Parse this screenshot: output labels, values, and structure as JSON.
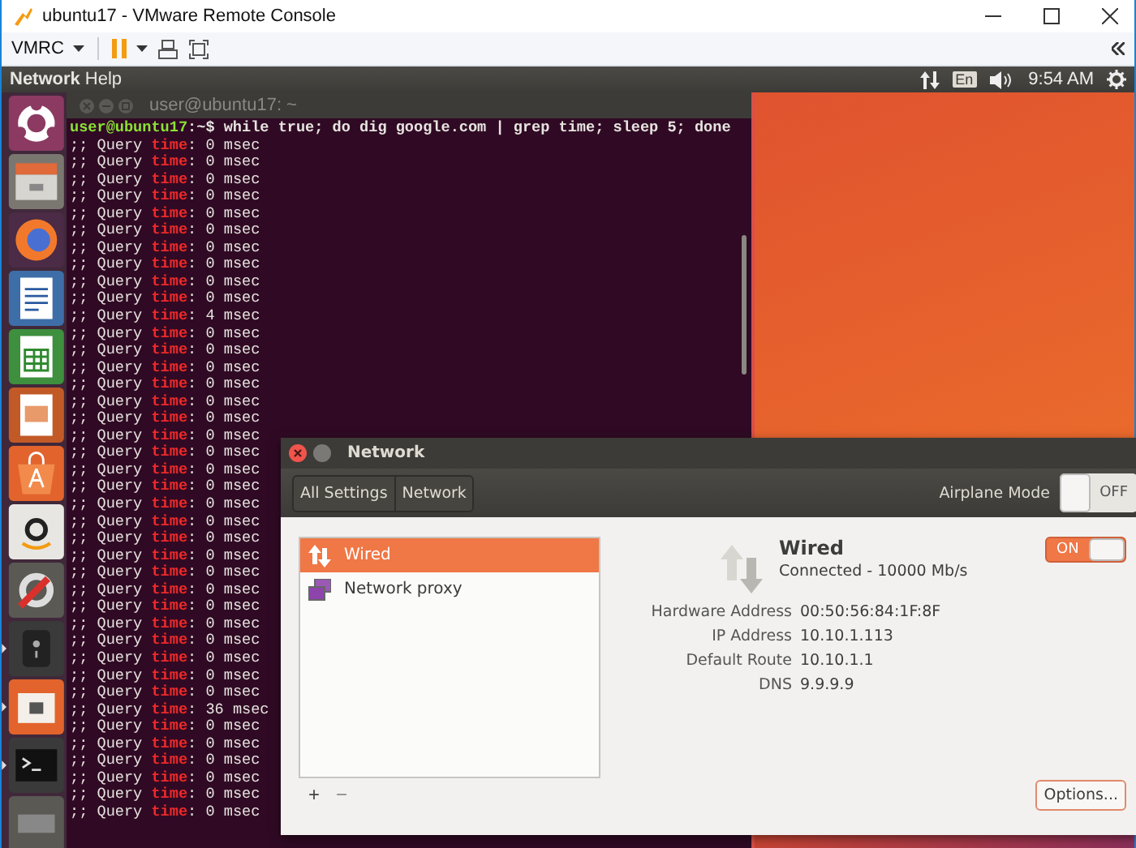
{
  "window": {
    "title": "ubuntu17 - VMware Remote Console"
  },
  "toolbar": {
    "menu": "VMRC"
  },
  "top_panel": {
    "app_menu": [
      {
        "label": "Network"
      },
      {
        "label": "Help"
      }
    ],
    "keyboard": "En",
    "clock": "9:54 AM"
  },
  "launcher": {
    "items": [
      {
        "kind": "dash",
        "running": false
      },
      {
        "kind": "files",
        "running": false
      },
      {
        "kind": "browser",
        "running": false
      },
      {
        "kind": "writer",
        "running": false
      },
      {
        "kind": "calc",
        "running": false
      },
      {
        "kind": "impress",
        "running": false
      },
      {
        "kind": "software",
        "running": false
      },
      {
        "kind": "amazon",
        "running": false
      },
      {
        "kind": "settings",
        "running": false
      },
      {
        "kind": "disk",
        "running": true
      },
      {
        "kind": "folder",
        "running": true
      },
      {
        "kind": "terminal",
        "running": true
      },
      {
        "kind": "drive",
        "running": false
      }
    ]
  },
  "terminal": {
    "title": "user@ubuntu17: ~",
    "prompt_user": "user@ubuntu17",
    "prompt_rest": ":~$ while true; do dig google.com | grep time; sleep 5; done",
    "lines": [
      {
        "before": ";; Query ",
        "match": "time",
        "after": ": 0 msec"
      },
      {
        "before": ";; Query ",
        "match": "time",
        "after": ": 0 msec"
      },
      {
        "before": ";; Query ",
        "match": "time",
        "after": ": 0 msec"
      },
      {
        "before": ";; Query ",
        "match": "time",
        "after": ": 0 msec"
      },
      {
        "before": ";; Query ",
        "match": "time",
        "after": ": 0 msec"
      },
      {
        "before": ";; Query ",
        "match": "time",
        "after": ": 0 msec"
      },
      {
        "before": ";; Query ",
        "match": "time",
        "after": ": 0 msec"
      },
      {
        "before": ";; Query ",
        "match": "time",
        "after": ": 0 msec"
      },
      {
        "before": ";; Query ",
        "match": "time",
        "after": ": 0 msec"
      },
      {
        "before": ";; Query ",
        "match": "time",
        "after": ": 0 msec"
      },
      {
        "before": ";; Query ",
        "match": "time",
        "after": ": 4 msec"
      },
      {
        "before": ";; Query ",
        "match": "time",
        "after": ": 0 msec"
      },
      {
        "before": ";; Query ",
        "match": "time",
        "after": ": 0 msec"
      },
      {
        "before": ";; Query ",
        "match": "time",
        "after": ": 0 msec"
      },
      {
        "before": ";; Query ",
        "match": "time",
        "after": ": 0 msec"
      },
      {
        "before": ";; Query ",
        "match": "time",
        "after": ": 0 msec"
      },
      {
        "before": ";; Query ",
        "match": "time",
        "after": ": 0 msec"
      },
      {
        "before": ";; Query ",
        "match": "time",
        "after": ": 0 msec"
      },
      {
        "before": ";; Query ",
        "match": "time",
        "after": ": 0 msec"
      },
      {
        "before": ";; Query ",
        "match": "time",
        "after": ": 0 msec"
      },
      {
        "before": ";; Query ",
        "match": "time",
        "after": ": 0 msec"
      },
      {
        "before": ";; Query ",
        "match": "time",
        "after": ": 0 msec"
      },
      {
        "before": ";; Query ",
        "match": "time",
        "after": ": 0 msec"
      },
      {
        "before": ";; Query ",
        "match": "time",
        "after": ": 0 msec"
      },
      {
        "before": ";; Query ",
        "match": "time",
        "after": ": 0 msec"
      },
      {
        "before": ";; Query ",
        "match": "time",
        "after": ": 0 msec"
      },
      {
        "before": ";; Query ",
        "match": "time",
        "after": ": 0 msec"
      },
      {
        "before": ";; Query ",
        "match": "time",
        "after": ": 0 msec"
      },
      {
        "before": ";; Query ",
        "match": "time",
        "after": ": 0 msec"
      },
      {
        "before": ";; Query ",
        "match": "time",
        "after": ": 0 msec"
      },
      {
        "before": ";; Query ",
        "match": "time",
        "after": ": 0 msec"
      },
      {
        "before": ";; Query ",
        "match": "time",
        "after": ": 0 msec"
      },
      {
        "before": ";; Query ",
        "match": "time",
        "after": ": 0 msec"
      },
      {
        "before": ";; Query ",
        "match": "time",
        "after": ": 36 msec"
      },
      {
        "before": ";; Query ",
        "match": "time",
        "after": ": 0 msec"
      },
      {
        "before": ";; Query ",
        "match": "time",
        "after": ": 0 msec"
      },
      {
        "before": ";; Query ",
        "match": "time",
        "after": ": 0 msec"
      },
      {
        "before": ";; Query ",
        "match": "time",
        "after": ": 0 msec"
      },
      {
        "before": ";; Query ",
        "match": "time",
        "after": ": 0 msec"
      },
      {
        "before": ";; Query ",
        "match": "time",
        "after": ": 0 msec"
      }
    ]
  },
  "network": {
    "title": "Network",
    "breadcrumb": [
      {
        "label": "All Settings"
      },
      {
        "label": "Network"
      }
    ],
    "airplane_mode": {
      "label": "Airplane Mode",
      "on": false,
      "state_text": "OFF"
    },
    "devices": [
      {
        "kind": "wired",
        "label": "Wired",
        "selected": true
      },
      {
        "kind": "proxy",
        "label": "Network proxy",
        "selected": false
      }
    ],
    "list_actions": [
      {
        "kind": "add",
        "label": "+"
      },
      {
        "kind": "remove",
        "label": "−"
      }
    ],
    "detail": {
      "name": "Wired",
      "status": "Connected - 10000 Mb/s",
      "switch": {
        "on": true,
        "state_text": "ON"
      },
      "properties": [
        {
          "label": "Hardware Address",
          "value": "00:50:56:84:1F:8F"
        },
        {
          "label": "IP Address",
          "value": "10.10.1.113"
        },
        {
          "label": "Default Route",
          "value": "10.10.1.1"
        },
        {
          "label": "DNS",
          "value": "9.9.9.9"
        }
      ],
      "options_button": "Options..."
    }
  }
}
